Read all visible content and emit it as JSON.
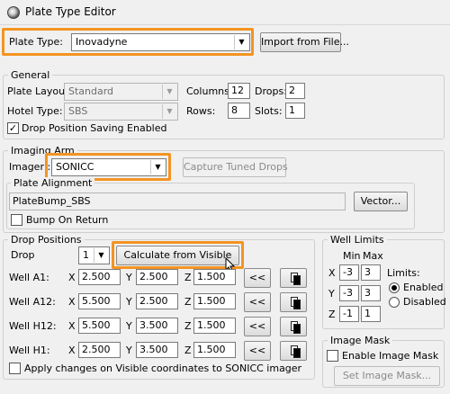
{
  "window": {
    "title": "Plate Type Editor"
  },
  "plate_type": {
    "label": "Plate Type:",
    "value": "Inovadyne",
    "import_button": "Import from File..."
  },
  "general": {
    "legend": "General",
    "plate_layout_label": "Plate Layout:",
    "plate_layout_value": "Standard",
    "columns_label": "Columns:",
    "columns_value": "12",
    "drops_label": "Drops:",
    "drops_value": "2",
    "hotel_type_label": "Hotel Type:",
    "hotel_type_value": "SBS",
    "rows_label": "Rows:",
    "rows_value": "8",
    "slots_label": "Slots:",
    "slots_value": "1",
    "drop_saving_label": "Drop Position Saving Enabled",
    "drop_saving_checked": true
  },
  "imaging_arm": {
    "legend": "Imaging Arm",
    "imager_label": "Imager :",
    "imager_value": "SONICC",
    "capture_button": "Capture Tuned Drops",
    "plate_alignment": {
      "legend": "Plate Alignment",
      "value": "PlateBump_SBS",
      "vector_button": "Vector...",
      "bump_label": "Bump On Return",
      "bump_checked": false
    }
  },
  "drop_positions": {
    "legend": "Drop Positions",
    "drop_label": "Drop",
    "drop_value": "1",
    "calculate_button": "Calculate from Visible",
    "rows": [
      {
        "label": "Well A1:",
        "x": "2.500",
        "y": "2.500",
        "z": "1.500"
      },
      {
        "label": "Well A12:",
        "x": "5.500",
        "y": "2.500",
        "z": "1.500"
      },
      {
        "label": "Well H12:",
        "x": "5.500",
        "y": "3.500",
        "z": "1.500"
      },
      {
        "label": "Well H1:",
        "x": "2.500",
        "y": "3.500",
        "z": "1.500"
      }
    ],
    "x_label": "X",
    "y_label": "Y",
    "z_label": "Z",
    "arrow_button": "<<",
    "apply_label": "Apply changes on Visible coordinates to SONICC imager",
    "apply_checked": false
  },
  "well_limits": {
    "legend": "Well Limits",
    "min_label": "Min",
    "max_label": "Max",
    "x_label": "X",
    "x_min": "-3",
    "x_max": "3",
    "y_label": "Y",
    "y_min": "-3",
    "y_max": "3",
    "z_label": "Z",
    "z_min": "-1",
    "z_max": "1",
    "limits_label": "Limits:",
    "enabled_label": "Enabled",
    "disabled_label": "Disabled",
    "selected": "Enabled"
  },
  "image_mask": {
    "legend": "Image Mask",
    "enable_label": "Enable Image Mask",
    "enable_checked": false,
    "set_button": "Set Image Mask..."
  },
  "colors": {
    "highlight": "#f39422",
    "background": "#f0f0f0"
  },
  "icons": {
    "app": "app-icon",
    "copy": "copy-icon",
    "dropdown": "chevron-down-icon",
    "check": "check-icon"
  }
}
